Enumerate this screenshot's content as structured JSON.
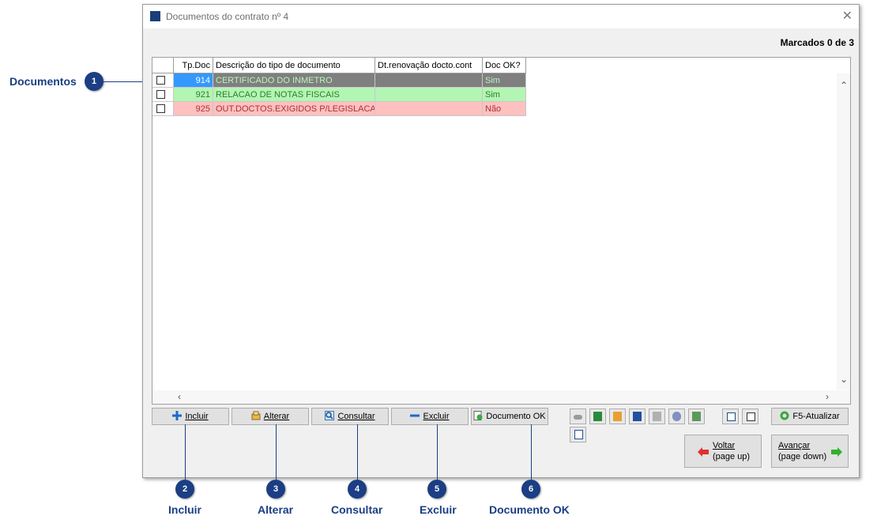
{
  "window": {
    "title": "Documentos do contrato nº 4",
    "marked": "Marcados 0 de 3"
  },
  "grid": {
    "headers": [
      "Tp.Doc",
      "Descrição do tipo de documento",
      "Dt.renovação docto.cont",
      "Doc OK?"
    ],
    "rows": [
      {
        "code": "914",
        "desc": "CERTIFICADO DO INMETRO",
        "date": "",
        "ok": "Sim"
      },
      {
        "code": "921",
        "desc": "RELACAO DE NOTAS FISCAIS",
        "date": "",
        "ok": "Sim"
      },
      {
        "code": "925",
        "desc": "OUT.DOCTOS.EXIGIDOS P/LEGISLACAO",
        "date": "",
        "ok": "Não"
      }
    ]
  },
  "buttons": {
    "incluir": "Incluir",
    "alterar": "Alterar",
    "consultar": "Consultar",
    "excluir": "Excluir",
    "documento_ok": "Documento OK",
    "atualizar": "F5-Atualizar",
    "voltar_1": "Voltar",
    "voltar_2": "(page up)",
    "avancar_1": "Avançar",
    "avancar_2": "(page down)"
  },
  "callouts": [
    {
      "n": "1",
      "label": "Documentos"
    },
    {
      "n": "2",
      "label": "Incluir"
    },
    {
      "n": "3",
      "label": "Alterar"
    },
    {
      "n": "4",
      "label": "Consultar"
    },
    {
      "n": "5",
      "label": "Excluir"
    },
    {
      "n": "6",
      "label": "Documento OK"
    }
  ],
  "colors": {
    "row_selected": "#7f7f7f",
    "row_ok": "#b3f5b3",
    "row_not_ok": "#ffc0c0",
    "code_selected": "#3399ff",
    "callout": "#1b3e84"
  },
  "icons": [
    "app-icon",
    "close-icon",
    "plus-icon",
    "edit-icon",
    "search-icon",
    "minus-icon",
    "doc-check-icon",
    "refresh-icon",
    "arrow-left-icon",
    "arrow-right-icon"
  ]
}
